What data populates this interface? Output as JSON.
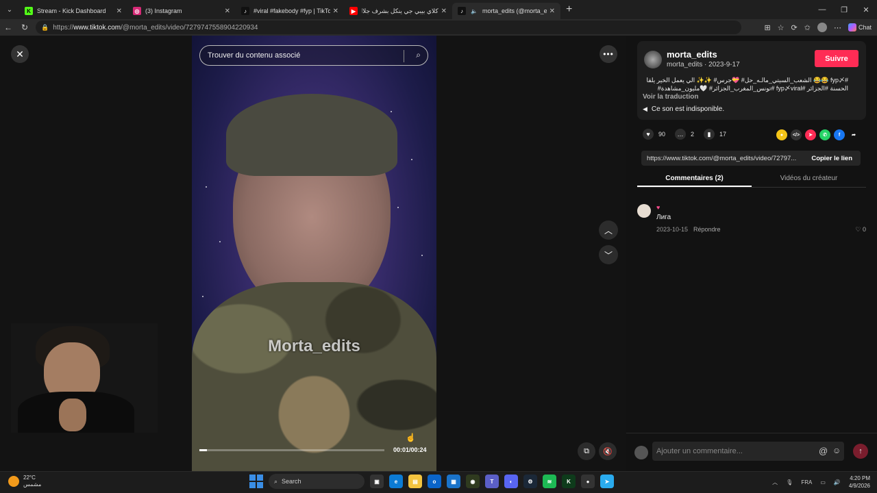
{
  "browser": {
    "tabs": [
      {
        "label": "Stream - Kick Dashboard",
        "icon": "kick-icon",
        "color": "#53fc18",
        "glyph": "K"
      },
      {
        "label": "(3) Instagram",
        "icon": "instagram-icon",
        "color": "#d62976",
        "glyph": "◎"
      },
      {
        "label": "#viral #fakebody #fyp | TikTok",
        "icon": "tiktok-icon",
        "color": "#111111",
        "glyph": "♪"
      },
      {
        "label": "كلاي بيبي جي ينكل بشرف جلال بريك",
        "icon": "youtube-icon",
        "color": "#ff0000",
        "glyph": "▶"
      },
      {
        "label": "morta_edits (@morta_edits) |",
        "icon": "tiktok-icon",
        "color": "#111111",
        "glyph": "♪"
      }
    ],
    "new_tab": "+",
    "url_prefix": "https://",
    "url_host": "www.tiktok.com",
    "url_path": "/@morta_edits/video/7279747558904220934",
    "chat_label": "Chat"
  },
  "video": {
    "search_placeholder": "Trouver du contenu associé",
    "watermark": "Morta_edits",
    "time": "00:01/00:24",
    "progress": 0.04
  },
  "post": {
    "username": "morta_edits",
    "meta": "morta_edits · 2023-9-17",
    "follow": "Suivre",
    "caption": "#fyp〆 😂😂 الشعب_السيتي_مالـه_حل# 💝جرس# ✨✨ الي يعمل الخير يلقا الحسنة #الجزائر #fyp〆viral #تونس_المغرب_الجزائر# 🤍مليون_مشاهدة#",
    "translate": "Voir la traduction",
    "sound": "Ce son est indisponible.",
    "likes": "90",
    "comments_count": "2",
    "saves": "17",
    "link": "https://www.tiktok.com/@morta_edits/video/72797...",
    "copy_link": "Copier le lien",
    "tab_comments": "Commentaires (2)",
    "tab_creator": "Vidéos du créateur"
  },
  "comment": {
    "heart": "♥",
    "text": "Лига",
    "date": "2023-10-15",
    "reply": "Répondre",
    "likes": "0"
  },
  "comment_box": {
    "placeholder": "Ajouter un commentaire...",
    "at": "@"
  },
  "taskbar": {
    "temp": "22°C",
    "weather": "مشمس",
    "search": "Search",
    "lang": "FRA",
    "time": "4:20 PM",
    "date": "4/9/2026"
  }
}
